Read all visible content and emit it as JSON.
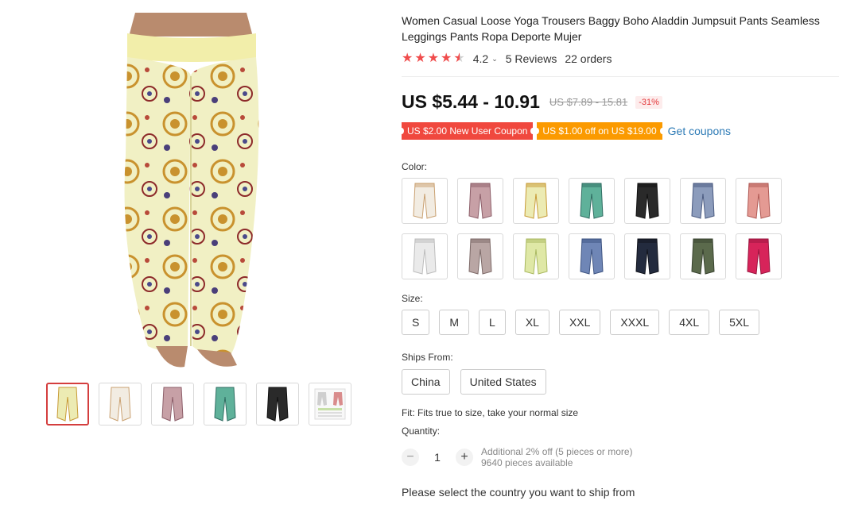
{
  "product": {
    "title": "Women Casual Loose Yoga Trousers Baggy Boho Aladdin Jumpsuit Pants Seamless Leggings Pants Ropa Deporte Mujer",
    "rating": "4.2",
    "reviews": "5 Reviews",
    "orders": "22 orders",
    "rating_value": 4.2
  },
  "price": {
    "current": "US $5.44 - 10.91",
    "original": "US $7.89 - 15.81",
    "discount": "-31%"
  },
  "coupons": {
    "new_user": "US $2.00 New User Coupon",
    "off": "US $1.00 off on US $19.00",
    "get": "Get coupons"
  },
  "color": {
    "label": "Color:",
    "swatches": [
      {
        "name": "cream-floral",
        "color": "#f2ece2",
        "accent": "#c9a070"
      },
      {
        "name": "mauve-floral",
        "color": "#c7a0a6",
        "accent": "#8d5f6a"
      },
      {
        "name": "yellow-mandala",
        "color": "#ecebb3",
        "accent": "#c79a35"
      },
      {
        "name": "green-floral",
        "color": "#5fb19a",
        "accent": "#2f6d62"
      },
      {
        "name": "black",
        "color": "#2a2a2a",
        "accent": "#111111"
      },
      {
        "name": "blue-paisley",
        "color": "#8c9cbc",
        "accent": "#4a5a80"
      },
      {
        "name": "coral-floral",
        "color": "#e49a93",
        "accent": "#b05a55"
      },
      {
        "name": "white",
        "color": "#eaeaea",
        "accent": "#bcbcbc"
      },
      {
        "name": "taupe-floral",
        "color": "#b9a6a4",
        "accent": "#7d6a68"
      },
      {
        "name": "lime",
        "color": "#dfe8a6",
        "accent": "#a9b860"
      },
      {
        "name": "denim-blue",
        "color": "#6f86b6",
        "accent": "#3e5482"
      },
      {
        "name": "navy",
        "color": "#232b3e",
        "accent": "#11141c"
      },
      {
        "name": "olive",
        "color": "#5b6a4c",
        "accent": "#394330"
      },
      {
        "name": "rose-red",
        "color": "#d7245a",
        "accent": "#9b1640"
      }
    ]
  },
  "size": {
    "label": "Size:",
    "options": [
      "S",
      "M",
      "L",
      "XL",
      "XXL",
      "XXXL",
      "4XL",
      "5XL"
    ]
  },
  "ships": {
    "label": "Ships From:",
    "options": [
      "China",
      "United States"
    ]
  },
  "fit": "Fit: Fits true to size, take your normal size",
  "quantity": {
    "label": "Quantity:",
    "value": "1",
    "minus": "−",
    "plus": "+",
    "additional": "Additional 2% off (5 pieces or more)",
    "available": "9640 pieces available"
  },
  "country_prompt": "Please select the country you want to ship from",
  "colors": {
    "accent_red": "#f0483e",
    "accent_orange": "#fb9a00",
    "link_blue": "#2e7bb6",
    "star": "#f04c4c"
  },
  "thumbnails": [
    {
      "name": "yellow-mandala",
      "color": "#ecebb3"
    },
    {
      "name": "cream-floral",
      "color": "#f2ece2"
    },
    {
      "name": "mauve-floral",
      "color": "#c7a0a6"
    },
    {
      "name": "green-floral",
      "color": "#5fb19a"
    },
    {
      "name": "black",
      "color": "#2a2a2a"
    },
    {
      "name": "size-chart",
      "color": "#f4f4f4"
    }
  ]
}
